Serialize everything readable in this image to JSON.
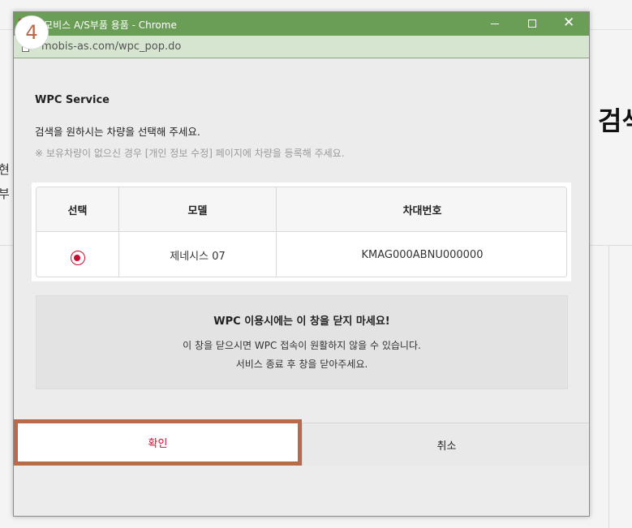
{
  "background_page": {
    "heading": "검색",
    "left_text_1": "현",
    "left_text_2": "부"
  },
  "popup": {
    "window_title": "대모비스 A/S부품 용품 - Chrome",
    "close_glyph": "✕",
    "url": "mobis-as.com/wpc_pop.do",
    "service_title": "WPC Service",
    "instruction": "검색을 원하시는 차량을 선택해 주세요.",
    "note": "※ 보유차량이 없으신 경우 [개인 정보 수정] 페이지에 차량을 등록해 주세요.",
    "table": {
      "headers": [
        "선택",
        "모델",
        "차대번호"
      ],
      "rows": [
        {
          "selected": true,
          "model": "제네시스 07",
          "vin": "KMAG000ABNU000000"
        }
      ]
    },
    "warning": {
      "title": "WPC 이용시에는 이 창을 닫지 마세요!",
      "line1": "이 창을 닫으시면 WPC 접속이 원활하지 않을 수 있습니다.",
      "line2": "서비스 종료 후 창을 닫아주세요."
    },
    "buttons": {
      "confirm": "확인",
      "cancel": "취소"
    }
  },
  "step_badge": "4",
  "colors": {
    "titlebar": "#6a9e57",
    "accent_red": "#c8102e",
    "highlight_frame": "#b86a4a"
  }
}
